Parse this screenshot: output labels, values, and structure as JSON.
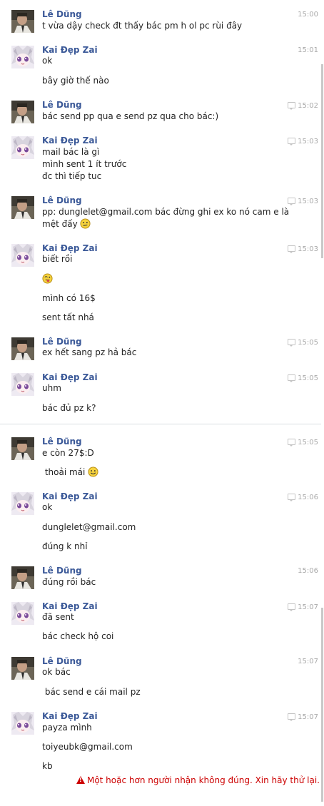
{
  "thread": {
    "blocks": [
      {
        "sender": "Lê Dũng",
        "avatar": "man",
        "time": "15:00",
        "seen": false,
        "messages": [
          "t vừa dậy check đt thấy bác pm h ol pc rùi đây"
        ]
      },
      {
        "sender": "Kai Đẹp Zai",
        "avatar": "anime",
        "time": "15:01",
        "seen": false,
        "messages": [
          "ok",
          "bây giờ thế nào"
        ]
      },
      {
        "sender": "Lê Dũng",
        "avatar": "man",
        "time": "15:02",
        "seen": true,
        "messages": [
          "bác send pp qua e send pz qua cho bác:)"
        ]
      },
      {
        "sender": "Kai Đẹp Zai",
        "avatar": "anime",
        "time": "15:03",
        "seen": true,
        "messages": [
          "mail bác là gì\nmình sent 1 ít trước\nđc thì tiếp tuc"
        ]
      },
      {
        "sender": "Lê Dũng",
        "avatar": "man",
        "time": "15:03",
        "seen": true,
        "messages": [
          "pp: dunglelet@gmail.com bác đừng ghi ex ko nó cam e là\nmệt đấy "
        ],
        "emoji": "unsure"
      },
      {
        "sender": "Kai Đẹp Zai",
        "avatar": "anime",
        "time": "15:03",
        "seen": true,
        "messages": [
          "biết rồi",
          "",
          "mình có 16$",
          "sent tất nhá"
        ]
      },
      {
        "sender": "Lê Dũng",
        "avatar": "man",
        "time": "15:05",
        "seen": true,
        "messages": [
          "ex hết sang pz hả bác"
        ]
      },
      {
        "sender": "Kai Đẹp Zai",
        "avatar": "anime",
        "time": "15:05",
        "seen": true,
        "messages": [
          "uhm",
          "bác đủ pz k?"
        ]
      },
      {
        "sender": "Lê Dũng",
        "avatar": "man",
        "time": "15:05",
        "seen": true,
        "messages": [
          "e còn 27$:D",
          " thoải mái "
        ]
      },
      {
        "sender": "Kai Đẹp Zai",
        "avatar": "anime",
        "time": "15:06",
        "seen": true,
        "messages": [
          "ok",
          "dunglelet@gmail.com",
          "đúng k nhỉ"
        ]
      },
      {
        "sender": "Lê Dũng",
        "avatar": "man",
        "time": "15:06",
        "seen": false,
        "messages": [
          "đúng rồi bác"
        ]
      },
      {
        "sender": "Kai Đẹp Zai",
        "avatar": "anime",
        "time": "15:07",
        "seen": true,
        "messages": [
          "đã sent",
          "bác check hộ coi"
        ]
      },
      {
        "sender": "Lê Dũng",
        "avatar": "man",
        "time": "15:07",
        "seen": false,
        "messages": [
          "ok bác",
          " bác send e cái mail pz"
        ]
      },
      {
        "sender": "Kai Đẹp Zai",
        "avatar": "anime",
        "time": "15:07",
        "seen": true,
        "messages": [
          "payza mình",
          "toiyeubk@gmail.com",
          "kb"
        ]
      }
    ]
  },
  "error_text": "Một hoặc hơn người nhận không đúng. Xin hãy thử lại.",
  "colors": {
    "name": "#3b5998",
    "error": "#cc0000",
    "time": "#a8a8a8"
  },
  "icons": {
    "seen": "seen-receipt-icon",
    "emoji_unsure": "unsure-smiley-icon",
    "emoji_smile": "smile-smiley-icon",
    "emoji_wink": "tongue-smiley-icon",
    "warning": "warning-icon"
  }
}
